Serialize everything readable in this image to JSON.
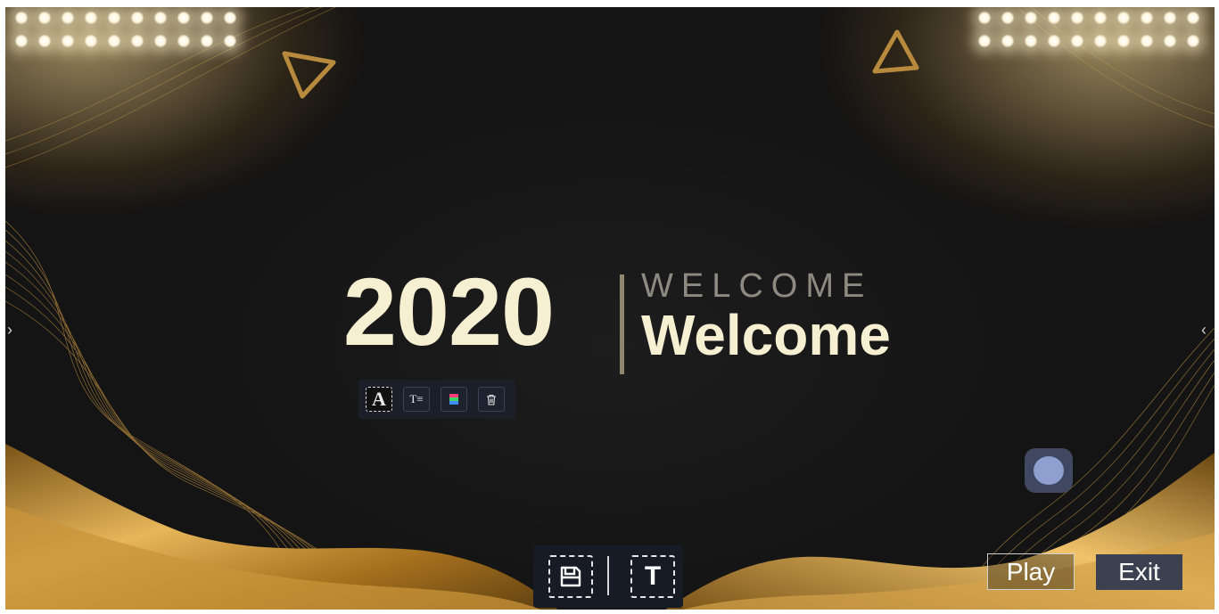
{
  "slide": {
    "year": "2020",
    "kicker": "WELCOME",
    "headline": "Welcome"
  },
  "edit_toolbar": [
    {
      "icon": "text-style-icon",
      "glyph": "A"
    },
    {
      "icon": "text-size-icon",
      "glyph": "T≡"
    },
    {
      "icon": "color-palette-icon",
      "glyph": ""
    },
    {
      "icon": "trash-icon",
      "glyph": ""
    }
  ],
  "bottom_toolbar": [
    {
      "icon": "save-icon"
    },
    {
      "icon": "add-text-icon",
      "glyph": "T"
    }
  ],
  "controls": {
    "play_label": "Play",
    "exit_label": "Exit"
  },
  "nav": {
    "left_glyph": "›",
    "right_glyph": "‹"
  },
  "colors": {
    "gold": "#d9a441",
    "text_cream": "#f7efd2",
    "kicker_gray": "#8e8a80",
    "toolbar_bg": "#1a1f29",
    "exit_bg": "#3b4150"
  }
}
